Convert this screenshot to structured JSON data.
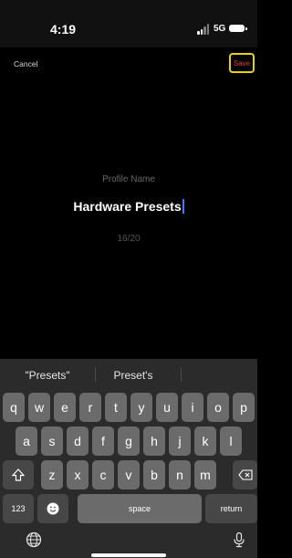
{
  "status": {
    "time": "4:19",
    "network": "5G"
  },
  "nav": {
    "cancel": "Cancel",
    "save": "Save"
  },
  "form": {
    "label": "Profile Name",
    "value": "Hardware Presets",
    "counter": "16/20"
  },
  "keyboard": {
    "suggestions": [
      "\"Presets\"",
      "Preset's",
      ""
    ],
    "row1": [
      "q",
      "w",
      "e",
      "r",
      "t",
      "y",
      "u",
      "i",
      "o",
      "p"
    ],
    "row2": [
      "a",
      "s",
      "d",
      "f",
      "g",
      "h",
      "j",
      "k",
      "l"
    ],
    "row3": [
      "z",
      "x",
      "c",
      "v",
      "b",
      "n",
      "m"
    ],
    "numbers_key": "123",
    "space_key": "space",
    "return_key": "return",
    "icons": {
      "shift": "shift-icon",
      "delete": "delete-icon",
      "emoji": "emoji-icon",
      "globe": "globe-icon",
      "mic": "microphone-icon"
    }
  },
  "colors": {
    "save_border": "#e7d300",
    "save_text": "#e23a2e",
    "caret": "#3a7bff"
  }
}
